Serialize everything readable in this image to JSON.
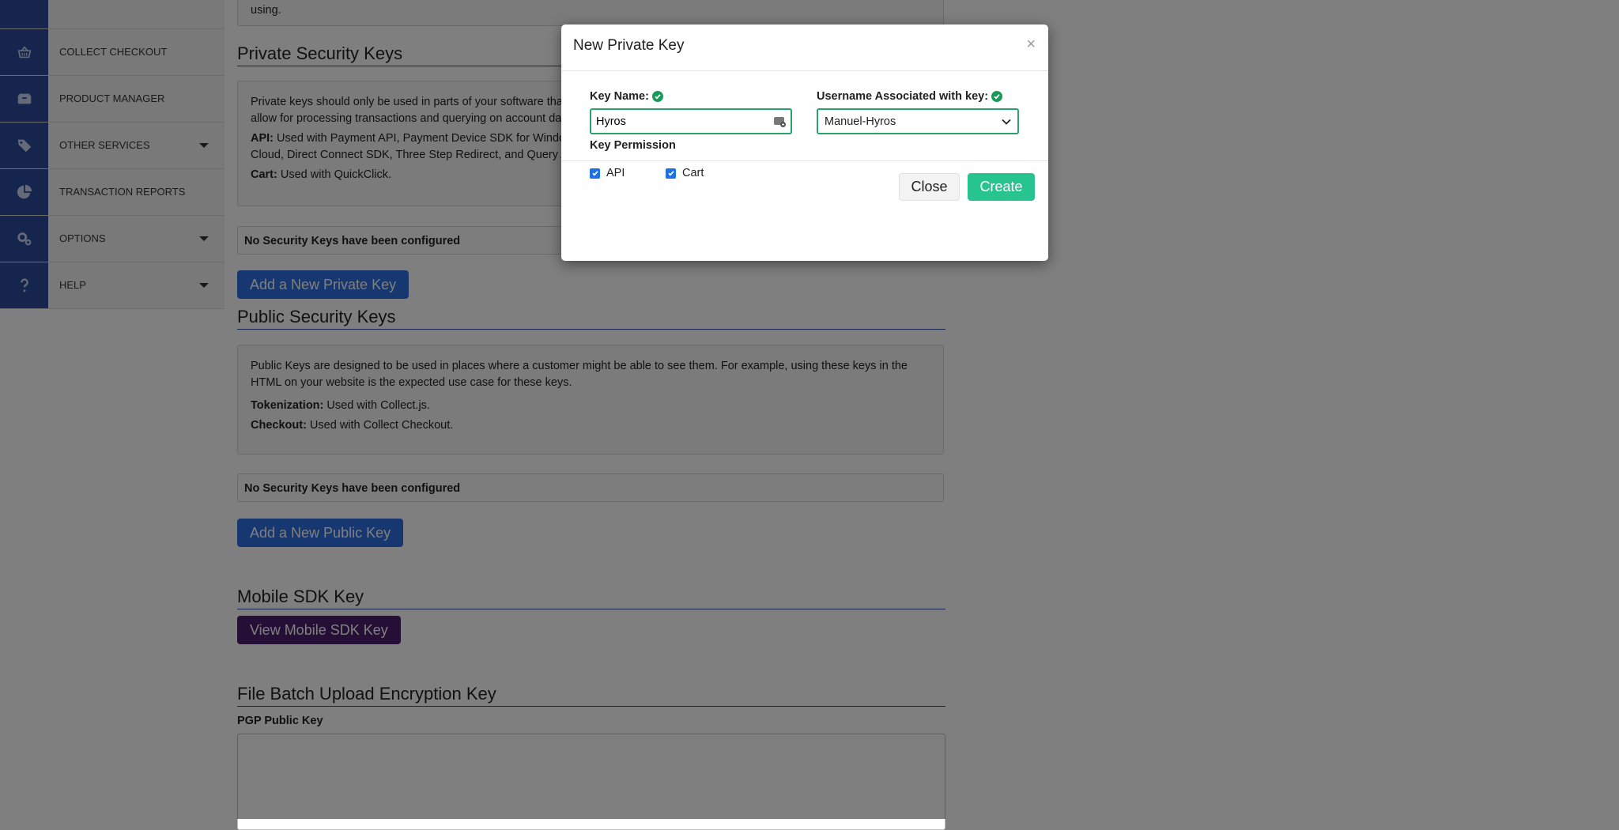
{
  "sidebar": {
    "items": [
      {
        "label": "",
        "icon": "blank-icon",
        "has_caret": false
      },
      {
        "label": "COLLECT CHECKOUT",
        "icon": "basket-icon",
        "has_caret": false
      },
      {
        "label": "PRODUCT MANAGER",
        "icon": "box-icon",
        "has_caret": false
      },
      {
        "label": "OTHER SERVICES",
        "icon": "tags-icon",
        "has_caret": true
      },
      {
        "label": "TRANSACTION REPORTS",
        "icon": "pie-chart-icon",
        "has_caret": false
      },
      {
        "label": "OPTIONS",
        "icon": "gears-icon",
        "has_caret": true
      },
      {
        "label": "HELP",
        "icon": "question-icon",
        "has_caret": true
      }
    ]
  },
  "main": {
    "top_text": "using.",
    "private": {
      "title": "Private Security Keys",
      "desc": "Private keys should only be used in parts of your software tha",
      "desc2": "allow for processing transactions and querying on account da",
      "api_label": "API:",
      "api_text": " Used with Payment API, Payment Device SDK for Windo",
      "api_text2": "Cloud, Direct Connect SDK, Three Step Redirect, and Query A",
      "cart_label": "Cart:",
      "cart_text": " Used with QuickClick.",
      "status": "No Security Keys have been configured",
      "button": "Add a New Private Key"
    },
    "public": {
      "title": "Public Security Keys",
      "desc": "Public Keys are designed to be used in places where a customer might be able to see them. For example, using these keys in the",
      "desc2": "HTML on your website is the expected use case for these keys.",
      "tok_label": "Tokenization:",
      "tok_text": " Used with Collect.js.",
      "checkout_label": "Checkout:",
      "checkout_text": " Used with Collect Checkout.",
      "status": "No Security Keys have been configured",
      "button": "Add a New Public Key"
    },
    "mobile": {
      "title": "Mobile SDK Key",
      "button": "View Mobile SDK Key"
    },
    "batch": {
      "title": "File Batch Upload Encryption Key",
      "pgp_label": "PGP Public Key"
    }
  },
  "modal": {
    "title": "New Private Key",
    "close_x": "×",
    "key_name_label": "Key Name:",
    "key_name_value": "Hyros",
    "username_label": "Username Associated with key:",
    "username_value": "Manuel-Hyros",
    "permission_label": "Key Permission",
    "perm_api": "API",
    "perm_cart": "Cart",
    "close_button": "Close",
    "create_button": "Create"
  },
  "colors": {
    "sidebar_icon_bg": "#2a4a9a",
    "primary_button": "#2f6fe0",
    "mobile_button": "#4a1f6e",
    "create_button": "#28c48f",
    "valid_green": "#1a9a5a"
  }
}
